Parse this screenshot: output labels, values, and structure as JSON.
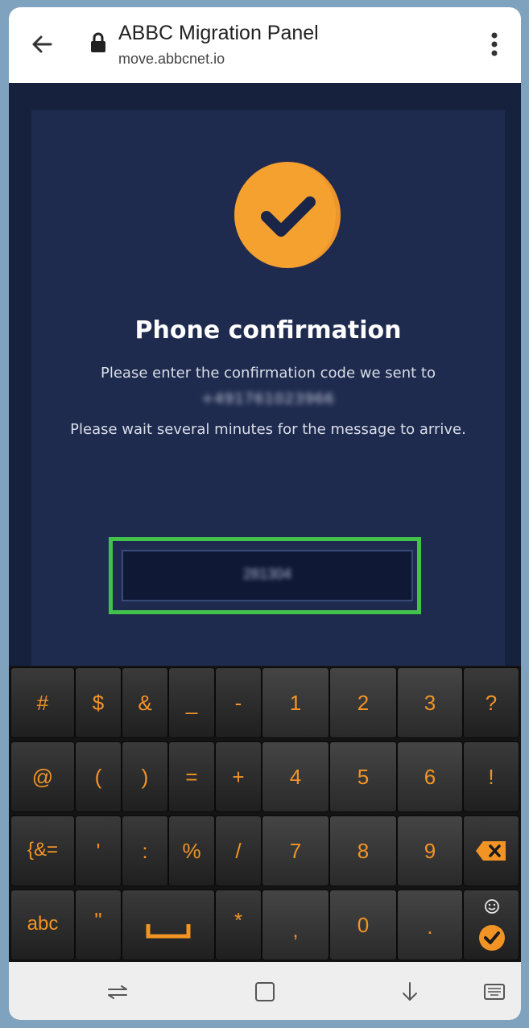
{
  "browser": {
    "title": "ABBC Migration Panel",
    "url": "move.abbcnet.io"
  },
  "page": {
    "heading": "Phone confirmation",
    "instruction": "Please enter the confirmation code we sent to",
    "phone_number": "+491761023966",
    "wait_note": "Please wait several minutes for the message to arrive.",
    "code_value": "281304"
  },
  "keyboard": {
    "rows": [
      [
        "#",
        "$",
        "&",
        "_",
        "-",
        "1",
        "2",
        "3",
        "?"
      ],
      [
        "@",
        "(",
        ")",
        "=",
        "+",
        "4",
        "5",
        "6",
        "!"
      ],
      [
        "{&=",
        "'",
        ":",
        "%",
        "/",
        "7",
        "8",
        "9"
      ],
      [
        "abc",
        "\"",
        "*",
        ",",
        "0",
        "."
      ]
    ]
  },
  "colors": {
    "accent_orange": "#f5a130",
    "highlight_green": "#41c34b",
    "page_background": "#1f2b4e"
  },
  "icons": {
    "back": "arrow-left-icon",
    "lock": "lock-icon",
    "menu": "more-vert-icon",
    "badge": "check-circle-icon",
    "backspace": "backspace-icon",
    "space": "space-bar-icon",
    "emoji": "emoji-icon",
    "done": "check-icon"
  }
}
